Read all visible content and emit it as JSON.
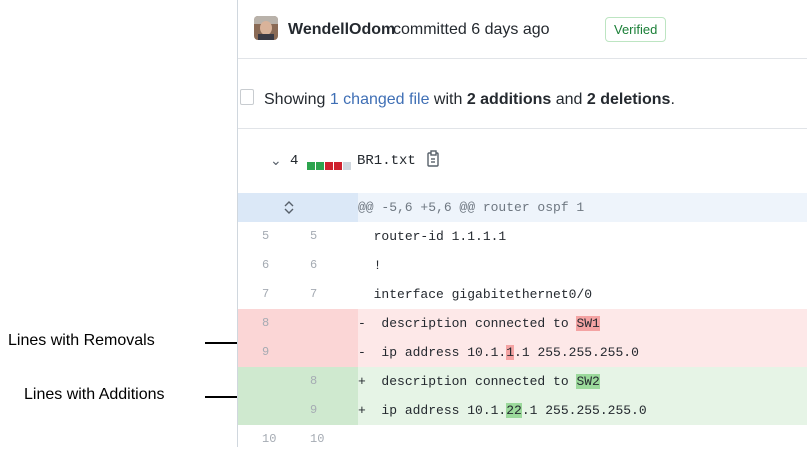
{
  "commit": {
    "author": "WendellOdom",
    "meta": "committed 6 days ago",
    "badge": "Verified"
  },
  "summary": {
    "prefix": "Showing ",
    "changed_files": "1 changed file",
    "mid": " with ",
    "additions": "2 additions",
    "and": " and ",
    "deletions": "2 deletions",
    "suffix": "."
  },
  "file": {
    "change_count": "4",
    "name": "BR1.txt",
    "blocks": [
      "#2da44e",
      "#2da44e",
      "#cf222e",
      "#cf222e",
      "#d0d7de"
    ]
  },
  "diff": {
    "hunk_header": "@@ -5,6 +5,6 @@ router ospf 1",
    "lines": [
      {
        "type": "context",
        "old": "5",
        "new": "5",
        "sign": " ",
        "pre": "router-id 1.1.1.1",
        "hl": "",
        "post": ""
      },
      {
        "type": "context",
        "old": "6",
        "new": "6",
        "sign": " ",
        "pre": "!",
        "hl": "",
        "post": ""
      },
      {
        "type": "context",
        "old": "7",
        "new": "7",
        "sign": " ",
        "pre": "interface gigabitethernet0/0",
        "hl": "",
        "post": ""
      },
      {
        "type": "del",
        "old": "8",
        "new": "",
        "sign": "-",
        "pre": " description connected to ",
        "hl": "SW1",
        "post": ""
      },
      {
        "type": "del",
        "old": "9",
        "new": "",
        "sign": "-",
        "pre": " ip address 10.1.",
        "hl": "1",
        "post": ".1 255.255.255.0"
      },
      {
        "type": "add",
        "old": "",
        "new": "8",
        "sign": "+",
        "pre": " description connected to ",
        "hl": "SW2",
        "post": ""
      },
      {
        "type": "add",
        "old": "",
        "new": "9",
        "sign": "+",
        "pre": " ip address 10.1.",
        "hl": "22",
        "post": ".1 255.255.255.0"
      },
      {
        "type": "context",
        "old": "10",
        "new": "10",
        "sign": " ",
        "pre": "",
        "hl": "",
        "post": ""
      }
    ]
  },
  "callouts": {
    "removals": "Lines with Removals",
    "additions": "Lines with Additions"
  }
}
